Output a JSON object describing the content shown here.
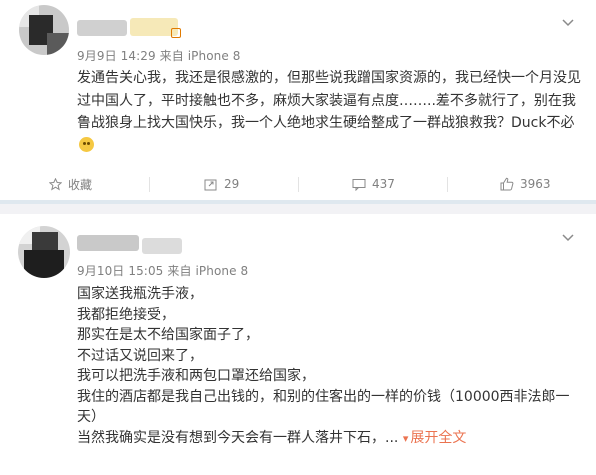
{
  "post1": {
    "date": "9月9日",
    "time": "14:29",
    "source_prefix": "来自",
    "source": "iPhone 8",
    "text": "发通告关心我，我还是很感激的，但那些说我蹭国家资源的，我已经快一个月没见过中国人了，平时接触也不多，麻烦大家装逼有点度……..差不多就行了，别在我鲁战狼身上找大国快乐，我一个人绝地求生硬给整成了一群战狼救我？Duck不必",
    "actions": {
      "favorite_label": "收藏",
      "forward_count": "29",
      "comment_count": "437",
      "like_count": "3963"
    }
  },
  "post2": {
    "date": "9月10日",
    "time": "15:05",
    "source_prefix": "来自",
    "source": "iPhone 8",
    "lines": [
      "国家送我瓶洗手液，",
      "我都拒绝接受，",
      "那实在是太不给国家面子了，",
      "不过话又说回来了，",
      "我可以把洗手液和两包口罩还给国家，",
      "我住的酒店都是我自己出钱的，和别的住客出的一样的价钱（10000西非法郎一天）",
      "当然我确实是没有想到今天会有一群人落井下石，..."
    ],
    "expand_label": "展开全文"
  },
  "icons": {
    "chevron": "chevron-down-icon",
    "favorite": "star-icon",
    "forward": "forward-icon",
    "comment": "comment-icon",
    "like": "thumbs-up-icon"
  },
  "colors": {
    "meta_text": "#808080",
    "body_text": "#333333",
    "expand_link": "#eb7350",
    "separator": "#f2f2f5"
  }
}
